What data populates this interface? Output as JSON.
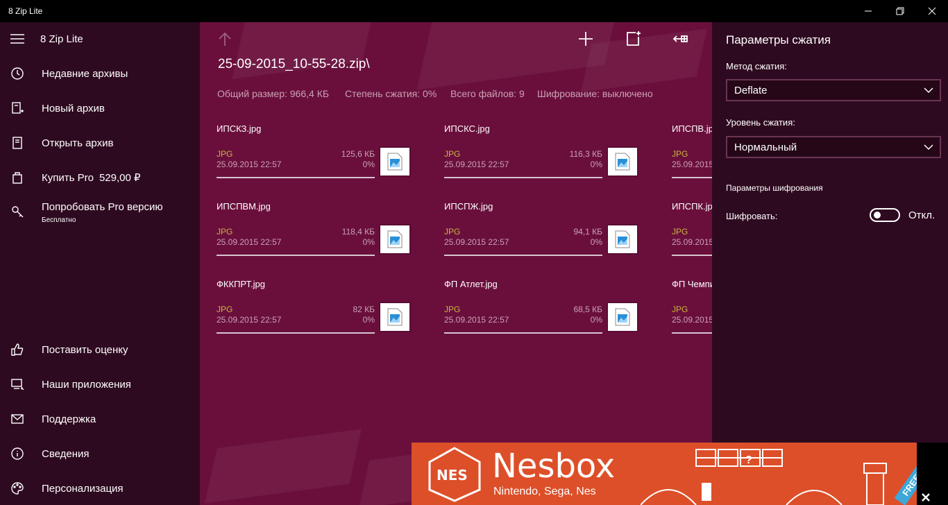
{
  "window": {
    "title": "8 Zip Lite"
  },
  "sidebar": {
    "app_name": "8 Zip Lite",
    "items": [
      {
        "label": "Недавние архивы",
        "icon": "clock-icon"
      },
      {
        "label": "Новый архив",
        "icon": "new-archive-icon"
      },
      {
        "label": "Открыть архив",
        "icon": "open-archive-icon"
      },
      {
        "label": "Купить Pro",
        "price": "529,00 ₽",
        "icon": "shopping-bag-icon"
      },
      {
        "label": "Попробовать Pro версию",
        "sub": "Бесплатно",
        "icon": "key-icon"
      }
    ],
    "bottom_items": [
      {
        "label": "Поставить оценку",
        "icon": "thumbs-up-icon"
      },
      {
        "label": "Наши приложения",
        "icon": "apps-icon"
      },
      {
        "label": "Поддержка",
        "icon": "mail-icon"
      },
      {
        "label": "Сведения",
        "icon": "info-icon"
      },
      {
        "label": "Персонализация",
        "icon": "palette-icon"
      }
    ]
  },
  "archive": {
    "path": "25-09-2015_10-55-28.zip\\",
    "info": {
      "total_size": "Общий размер: 966,4 КБ",
      "compression": "Степень сжатия: 0%",
      "file_count": "Всего файлов: 9",
      "encryption": "Шифрование: выключено"
    },
    "files": [
      {
        "name": "ИПСКЗ.jpg",
        "type": "JPG",
        "date": "25.09.2015 22:57",
        "size": "125,6 КБ",
        "ratio": "0%"
      },
      {
        "name": "ИПСКС.jpg",
        "type": "JPG",
        "date": "25.09.2015 22:57",
        "size": "116,3 КБ",
        "ratio": "0%"
      },
      {
        "name": "ИПСПВ.jpg",
        "type": "JPG",
        "date": "25.09.2015",
        "size": "",
        "ratio": ""
      },
      {
        "name": "ИПСПВМ.jpg",
        "type": "JPG",
        "date": "25.09.2015 22:57",
        "size": "118,4 КБ",
        "ratio": "0%"
      },
      {
        "name": "ИПСПЖ.jpg",
        "type": "JPG",
        "date": "25.09.2015 22:57",
        "size": "94,1 КБ",
        "ratio": "0%"
      },
      {
        "name": "ИПСПК.jpg",
        "type": "JPG",
        "date": "25.09.2015",
        "size": "",
        "ratio": ""
      },
      {
        "name": "ФККПРТ.jpg",
        "type": "JPG",
        "date": "25.09.2015 22:57",
        "size": "82 КБ",
        "ratio": "0%"
      },
      {
        "name": "ФП Атлет.jpg",
        "type": "JPG",
        "date": "25.09.2015 22:57",
        "size": "68,5 КБ",
        "ratio": "0%"
      },
      {
        "name": "ФП Чемпи",
        "type": "JPG",
        "date": "25.09.2015",
        "size": "",
        "ratio": ""
      }
    ]
  },
  "toolbar": {
    "up_icon": "arrow-up-icon",
    "add_icon": "plus-icon",
    "new_icon": "new-file-icon",
    "extract_icon": "extract-icon"
  },
  "settings": {
    "title": "Параметры сжатия",
    "method_label": "Метод сжатия:",
    "method_value": "Deflate",
    "level_label": "Уровень сжатия:",
    "level_value": "Нормальный",
    "encryption_header": "Параметры шифрования",
    "encrypt_label": "Шифровать:",
    "encrypt_state": "Откл."
  },
  "ad": {
    "title": "Nesbox",
    "subtitle": "Nintendo, Sega, Nes",
    "logo_text": "NES",
    "badge": "FREE!",
    "colors": {
      "background": "#dd4f29",
      "badge": "#3da7d9"
    }
  },
  "colors": {
    "main_bg": "#6a0f3c",
    "sidebar_bg": "#2e0a20",
    "file_type": "#c8b53c",
    "secondary_text": "#c9a2b4"
  }
}
